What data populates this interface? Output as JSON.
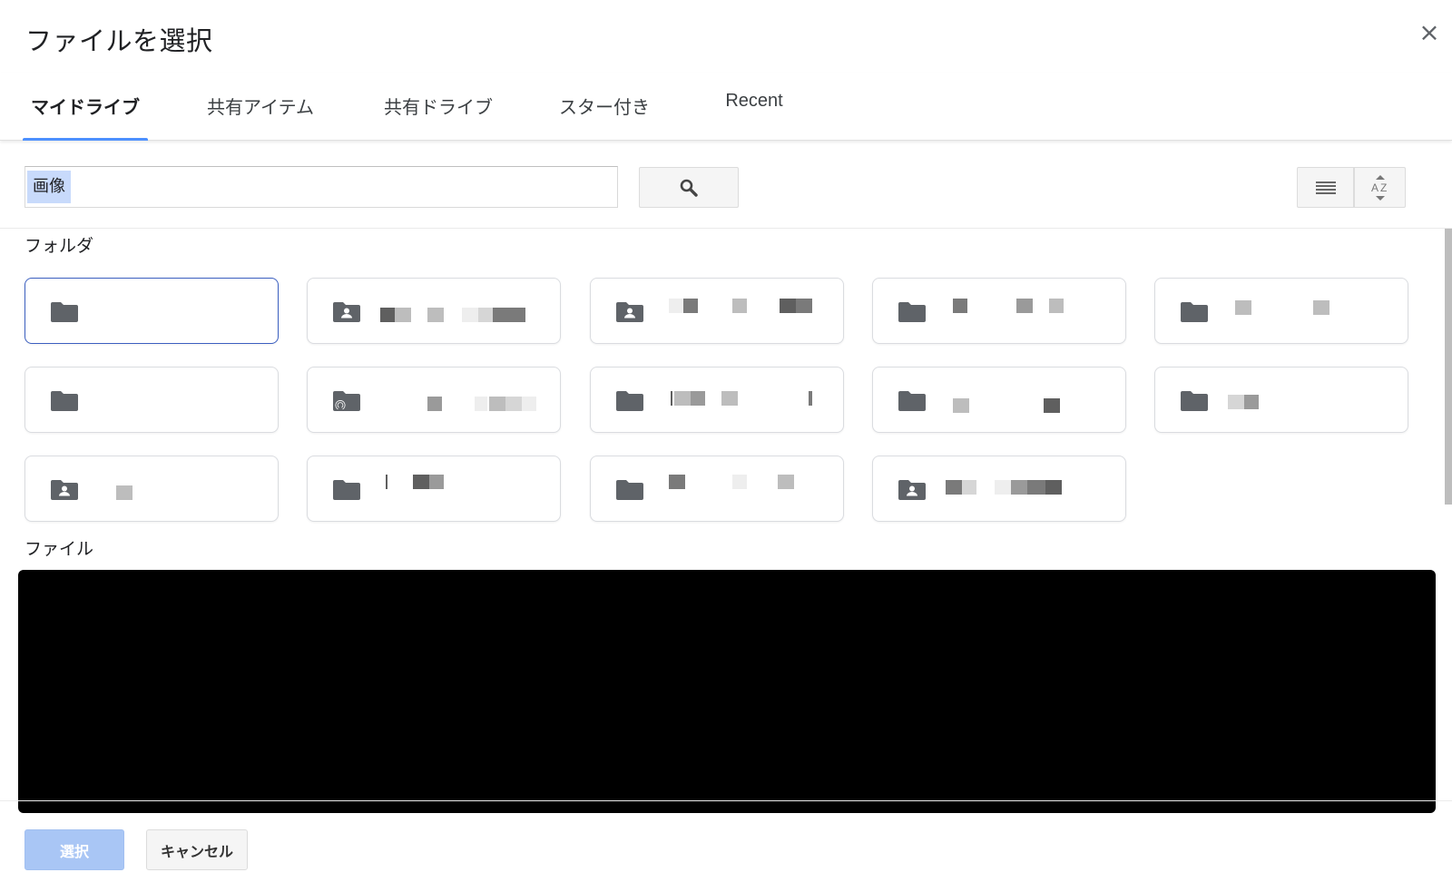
{
  "dialog": {
    "title": "ファイルを選択",
    "close_label": "×"
  },
  "tabs": [
    {
      "label": "マイドライブ",
      "active": true
    },
    {
      "label": "共有アイテム",
      "active": false
    },
    {
      "label": "共有ドライブ",
      "active": false
    },
    {
      "label": "スター付き",
      "active": false
    },
    {
      "label": "Recent",
      "active": false
    }
  ],
  "search": {
    "value": "画像"
  },
  "sections": {
    "folders_label": "フォルダ",
    "files_label": "ファイル"
  },
  "folders": [
    {
      "icon": "folder-icon",
      "selected": true
    },
    {
      "icon": "shared-folder-icon",
      "selected": false
    },
    {
      "icon": "shared-folder-icon",
      "selected": false
    },
    {
      "icon": "folder-icon",
      "selected": false
    },
    {
      "icon": "folder-icon",
      "selected": false
    },
    {
      "icon": "folder-icon",
      "selected": false
    },
    {
      "icon": "shortcut-folder-icon",
      "selected": false
    },
    {
      "icon": "folder-icon",
      "selected": false
    },
    {
      "icon": "folder-icon",
      "selected": false
    },
    {
      "icon": "folder-icon",
      "selected": false
    },
    {
      "icon": "shared-folder-icon",
      "selected": false
    },
    {
      "icon": "folder-icon",
      "selected": false
    },
    {
      "icon": "folder-icon",
      "selected": false
    },
    {
      "icon": "shared-folder-icon",
      "selected": false
    }
  ],
  "footer": {
    "select_label": "選択",
    "cancel_label": "キャンセル"
  },
  "colors": {
    "accent": "#4d90fe",
    "selected_border": "#3b5fc0",
    "primary_disabled": "#a9c6f5",
    "icon": "#5f6368",
    "redacted": "#000000"
  }
}
